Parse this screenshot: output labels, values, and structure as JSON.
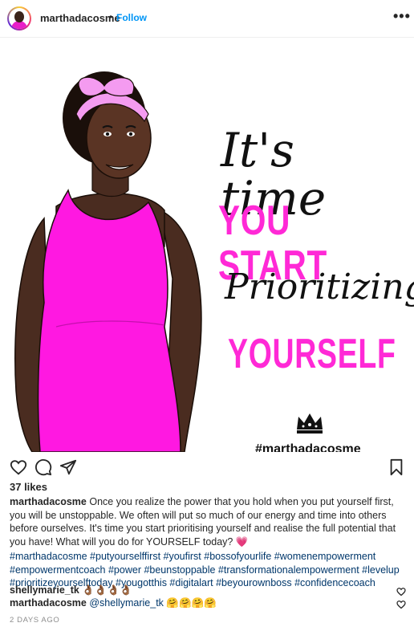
{
  "header": {
    "username": "marthadacosme",
    "separator": "•",
    "follow_label": "Follow",
    "more_label": "•••"
  },
  "post": {
    "art": {
      "line1": "It's time",
      "line2": "YOU START",
      "line3": "Prioritizing",
      "line4": "YOURSELF",
      "hashtag": "#marthadacosme",
      "accent_color": "#ff29d6"
    },
    "likes": "37 likes",
    "caption_user": "marthadacosme",
    "caption_text": " Once you realize the power that you hold when you put yourself first, you will be unstoppable. We often will put so much of our energy and time into others before ourselves. It's time you start prioritising yourself and realise the full potential that you have! What will you do for YOURSELF today? 💗",
    "hashtags_line1": "#marthadacosme #putyourselffirst #youfirst #bossofyourlife #womenempowerment",
    "hashtags_line2": "#empowermentcoach #power #beunstoppable #transformationalempowerment #levelup",
    "hashtags_line3": "#prioritizeyourselftoday #yougotthis #digitalart #beyourownboss #confidencecoach"
  },
  "comments": [
    {
      "user": "shellymarie_tk",
      "mention": "",
      "text": " 👌🏾👌🏾👌🏾👌🏾"
    },
    {
      "user": "marthadacosme",
      "mention": " @shellymarie_tk",
      "text": " 🤗🤗🤗🤗"
    }
  ],
  "date": "2 DAYS AGO"
}
